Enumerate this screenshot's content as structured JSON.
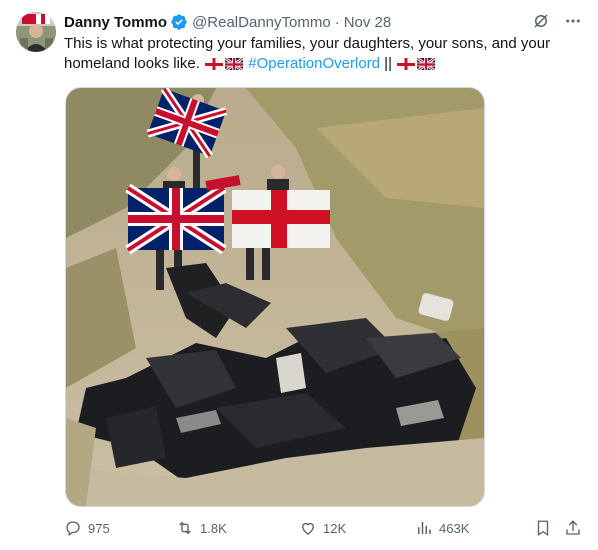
{
  "author": {
    "name": "Danny Tommo",
    "handle": "@RealDannyTommo",
    "separator": "·",
    "date": "Nov 28"
  },
  "tweet": {
    "text_part1": "This is what protecting your families, your daughters, your sons, and your homeland looks like.",
    "hashtag": "#OperationOverlord",
    "separator": "||"
  },
  "metrics": {
    "replies": "975",
    "retweets": "1.8K",
    "likes": "12K",
    "views": "463K"
  },
  "icons": {
    "verified": "verified-badge-icon",
    "grok": "grok-icon",
    "more": "more-icon",
    "reply": "reply-icon",
    "retweet": "retweet-icon",
    "like": "heart-icon",
    "views": "views-chart-icon",
    "bookmark": "bookmark-icon",
    "share": "share-icon"
  },
  "colors": {
    "accent": "#1d9bf0",
    "text": "#0f1419",
    "secondary": "#536471"
  }
}
